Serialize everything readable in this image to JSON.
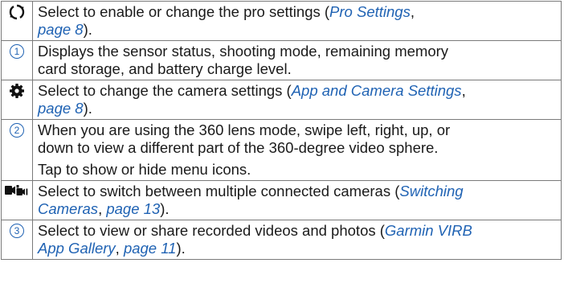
{
  "rows": [
    {
      "icon": "pro-settings-icon",
      "lines": [
        {
          "parts": [
            {
              "t": "Select to enable or change the pro settings ("
            },
            {
              "t": "Pro Settings",
              "link": true
            },
            {
              "t": ","
            }
          ]
        },
        {
          "parts": [
            {
              "t": "page 8",
              "link": true
            },
            {
              "t": ")."
            }
          ]
        }
      ]
    },
    {
      "icon": "callout-1-icon",
      "callout": "1",
      "lines": [
        {
          "parts": [
            {
              "t": "Displays the sensor status, shooting mode, remaining memory"
            }
          ]
        },
        {
          "parts": [
            {
              "t": "card storage, and battery charge level."
            }
          ]
        }
      ]
    },
    {
      "icon": "gear-icon",
      "lines": [
        {
          "parts": [
            {
              "t": "Select to change the camera settings ("
            },
            {
              "t": "App and Camera Settings",
              "link": true
            },
            {
              "t": ","
            }
          ]
        },
        {
          "parts": [
            {
              "t": "page 8",
              "link": true
            },
            {
              "t": ")."
            }
          ]
        }
      ]
    },
    {
      "icon": "callout-2-icon",
      "callout": "2",
      "lines": [
        {
          "parts": [
            {
              "t": "When you are using the 360 lens mode, swipe left, right, up, or"
            }
          ]
        },
        {
          "parts": [
            {
              "t": "down to view a different part of the 360-degree video sphere."
            }
          ]
        },
        {
          "para": true,
          "parts": [
            {
              "t": "Tap to show or hide menu icons."
            }
          ]
        }
      ]
    },
    {
      "icon": "switch-cameras-icon",
      "lines": [
        {
          "parts": [
            {
              "t": "Select to switch between multiple connected cameras ("
            },
            {
              "t": "Switching",
              "link": true
            }
          ]
        },
        {
          "parts": [
            {
              "t": "Cameras",
              "link": true
            },
            {
              "t": ", "
            },
            {
              "t": "page 13",
              "link": true
            },
            {
              "t": ")."
            }
          ]
        }
      ]
    },
    {
      "icon": "callout-3-icon",
      "callout": "3",
      "lines": [
        {
          "parts": [
            {
              "t": "Select to view or share recorded videos and photos ("
            },
            {
              "t": "Garmin VIRB",
              "link": true
            }
          ]
        },
        {
          "parts": [
            {
              "t": "App Gallery",
              "link": true
            },
            {
              "t": ", "
            },
            {
              "t": "page 11",
              "link": true
            },
            {
              "t": ")."
            }
          ]
        }
      ]
    }
  ],
  "colors": {
    "text": "#1a1a1a",
    "link": "#1f62b3",
    "border": "#7a7a7a"
  }
}
